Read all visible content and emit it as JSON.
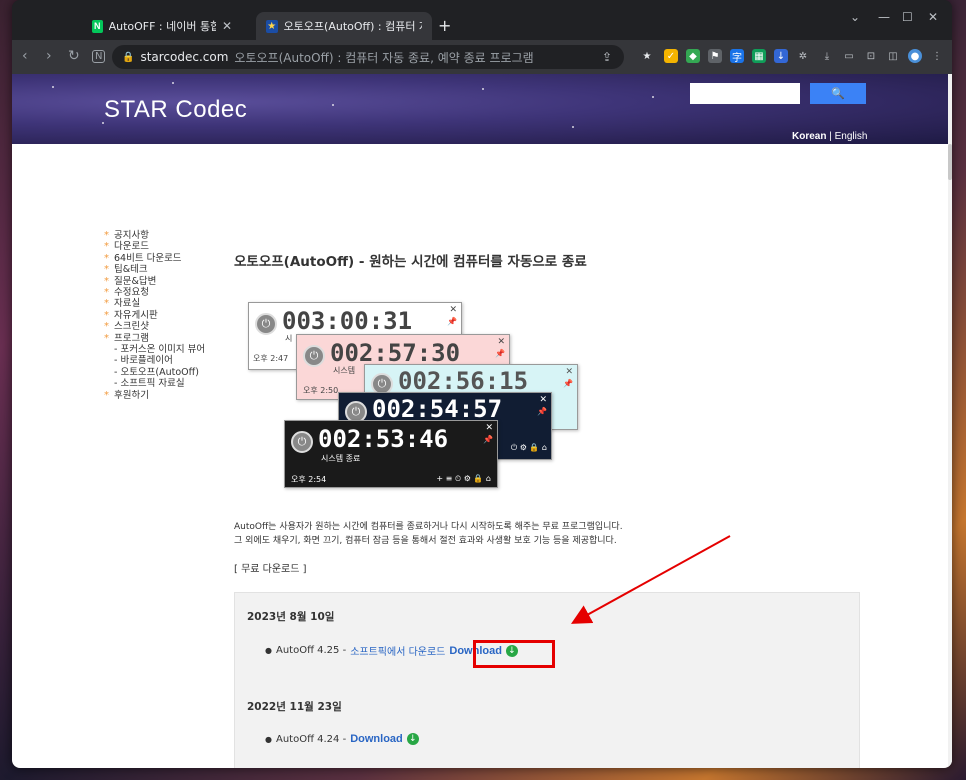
{
  "browser": {
    "tabs": [
      {
        "title": "AutoOFF : 네이버 통합검색",
        "icon": "naver-n-icon"
      },
      {
        "title": "오토오프(AutoOff) : 컴퓨터 자동",
        "icon": "star-codec-icon"
      }
    ],
    "new_tab": "+",
    "address": {
      "domain": "starcodec.com",
      "page_title": "오토오프(AutoOff) : 컴퓨터 자동 종료, 예약 종료 프로그램"
    }
  },
  "site": {
    "logo": "STAR Codec",
    "search_button": "🔍",
    "lang_korean": "Korean",
    "lang_separator": " | ",
    "lang_english": "English"
  },
  "menu": [
    {
      "label": "공지사항",
      "bullet": true
    },
    {
      "label": "다운로드",
      "bullet": true
    },
    {
      "label": "64비트 다운로드",
      "bullet": true
    },
    {
      "label": "팁&테크",
      "bullet": true
    },
    {
      "label": "질문&답변",
      "bullet": true
    },
    {
      "label": "수정요청",
      "bullet": true
    },
    {
      "label": "자료실",
      "bullet": true
    },
    {
      "label": "자유게시판",
      "bullet": true
    },
    {
      "label": "스크린샷",
      "bullet": true
    },
    {
      "label": "프로그램",
      "bullet": true
    },
    {
      "label": "- 포커스온 이미지 뷰어",
      "bullet": false
    },
    {
      "label": "- 바로플레이어",
      "bullet": false
    },
    {
      "label": "- 오토오프(AutoOff)",
      "bullet": false
    },
    {
      "label": "- 소프트픽 자료실",
      "bullet": false
    },
    {
      "label": "후원하기",
      "bullet": true
    }
  ],
  "main": {
    "heading": "오토오프(AutoOff) - 원하는 시간에 컴퓨터를 자동으로 종료",
    "clocks": [
      {
        "time": "003:00:31",
        "label": "시",
        "footer": "오후 2:47"
      },
      {
        "time": "002:57:30",
        "label": "시스템",
        "footer": "오후 2:50"
      },
      {
        "time": "002:56:15",
        "label": "",
        "footer": ""
      },
      {
        "time": "002:54:57",
        "label": "",
        "footer": ""
      },
      {
        "time": "002:53:46",
        "label": "시스템 종료",
        "footer": "오후 2:54"
      }
    ],
    "desc_line1": "AutoOff는 사용자가 원하는 시간에 컴퓨터를 종료하거나 다시 시작하도록 해주는 무료 프로그램입니다.",
    "desc_line2": "그 외에도 채우기, 화면 끄기, 컴퓨터 잠금 등을 통해서 절전 효과와 사생활 보호 기능 등을 제공합니다.",
    "free_download": "[ 무료 다운로드 ]",
    "releases": [
      {
        "date": "2023년 8월 10일",
        "version": "AutoOff 4.25 - ",
        "mirror": "소프트픽에서 다운로드",
        "download": "Download"
      },
      {
        "date": "2022년 11월 23일",
        "version": "AutoOff 4.24 - ",
        "mirror": "",
        "download": "Download"
      }
    ]
  },
  "colors": {
    "accent_blue": "#3b82f6",
    "link": "#2a66c4",
    "highlight": "#e50000",
    "bullet_orange": "#f29b3e"
  }
}
